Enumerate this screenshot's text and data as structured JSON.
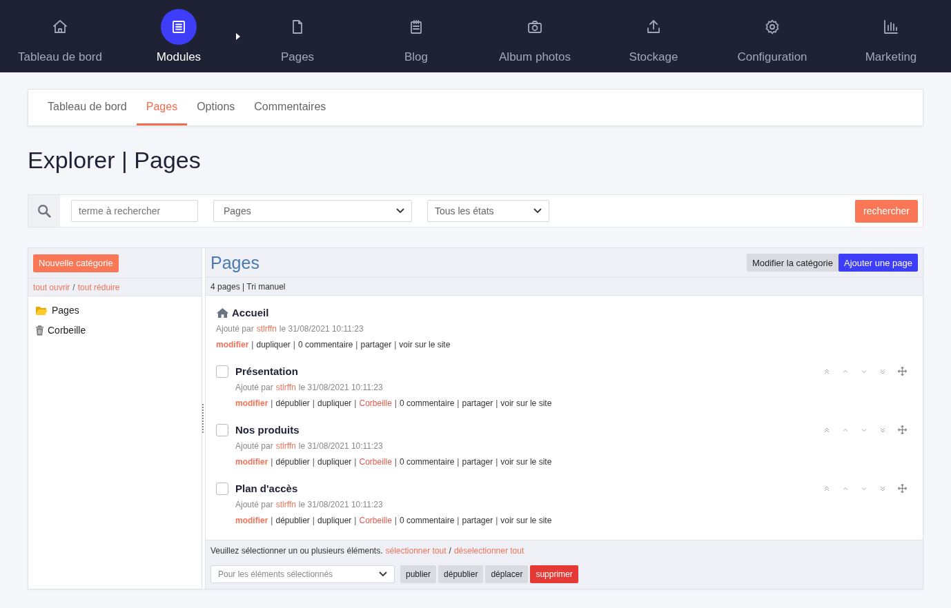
{
  "top_nav": [
    {
      "label": "Tableau de bord",
      "kind": "home",
      "selected": false
    },
    {
      "label": "Modules",
      "kind": "list",
      "selected": true
    },
    {
      "label": "Pages",
      "kind": "file",
      "selected": false
    },
    {
      "label": "Blog",
      "kind": "notepad",
      "selected": false
    },
    {
      "label": "Album photos",
      "kind": "camera",
      "selected": false
    },
    {
      "label": "Stockage",
      "kind": "upload",
      "selected": false
    },
    {
      "label": "Configuration",
      "kind": "gear",
      "selected": false
    },
    {
      "label": "Marketing",
      "kind": "chart",
      "selected": false
    }
  ],
  "sub_tabs": [
    {
      "label": "Tableau de bord",
      "selected": false
    },
    {
      "label": "Pages",
      "selected": true
    },
    {
      "label": "Options",
      "selected": false
    },
    {
      "label": "Commentaires",
      "selected": false
    }
  ],
  "page_title": "Explorer | Pages",
  "search": {
    "placeholder": "terme à rechercher",
    "category": "Pages",
    "state": "Tous les états",
    "button": "rechercher"
  },
  "sidebar": {
    "new_button": "Nouvelle catégorie",
    "expand_all": "tout ouvrir",
    "slash": "/",
    "collapse_all": "tout réduire",
    "tree": [
      {
        "label": "Pages",
        "kind": "folder"
      },
      {
        "label": "Corbeille",
        "kind": "trash"
      }
    ]
  },
  "content": {
    "title": "Pages",
    "buttons": [
      {
        "label": "Modifier la catégorie",
        "kind": "secondary"
      },
      {
        "label": "Ajouter une page",
        "kind": "primary"
      }
    ],
    "summary": "4 pages | Tri manuel",
    "pages": [
      {
        "title": "Accueil",
        "kind": "home",
        "added_by": "Ajouté par",
        "author": "stlrffn",
        "date": "le 31/08/2021 10:11:23",
        "actions": [
          {
            "label": "modifier",
            "kind": "edit"
          },
          {
            "sep": "|",
            "label": "dupliquer",
            "kind": "normal"
          },
          {
            "sep": "|",
            "label": "0 commentaire",
            "kind": "normal"
          },
          {
            "sep": "|",
            "label": "partager",
            "kind": "normal"
          },
          {
            "sep": "|",
            "label": "voir sur le site",
            "kind": "normal"
          }
        ]
      },
      {
        "title": "Présentation",
        "kind": "page",
        "checked": false,
        "added_by": "Ajouté par",
        "author": "stlrffn",
        "date": "le 31/08/2021 10:11:23",
        "actions": [
          {
            "label": "modifier",
            "kind": "edit"
          },
          {
            "sep": "|",
            "label": "dépublier",
            "kind": "normal"
          },
          {
            "sep": "|",
            "label": "dupliquer",
            "kind": "normal"
          },
          {
            "sep": "|",
            "label": "Corbeille",
            "kind": "trash"
          },
          {
            "sep": "|",
            "label": "0 commentaire",
            "kind": "normal"
          },
          {
            "sep": "|",
            "label": "partager",
            "kind": "normal"
          },
          {
            "sep": "|",
            "label": "voir sur le site",
            "kind": "normal"
          }
        ]
      },
      {
        "title": "Nos produits",
        "kind": "page",
        "checked": false,
        "added_by": "Ajouté par",
        "author": "stlrffn",
        "date": "le 31/08/2021 10:11:23",
        "actions": [
          {
            "label": "modifier",
            "kind": "edit"
          },
          {
            "sep": "|",
            "label": "dépublier",
            "kind": "normal"
          },
          {
            "sep": "|",
            "label": "dupliquer",
            "kind": "normal"
          },
          {
            "sep": "|",
            "label": "Corbeille",
            "kind": "trash"
          },
          {
            "sep": "|",
            "label": "0 commentaire",
            "kind": "normal"
          },
          {
            "sep": "|",
            "label": "partager",
            "kind": "normal"
          },
          {
            "sep": "|",
            "label": "voir sur le site",
            "kind": "normal"
          }
        ]
      },
      {
        "title": "Plan d'accès",
        "kind": "page",
        "checked": false,
        "added_by": "Ajouté par",
        "author": "stlrffn",
        "date": "le 31/08/2021 10:11:23",
        "actions": [
          {
            "label": "modifier",
            "kind": "edit"
          },
          {
            "sep": "|",
            "label": "dépublier",
            "kind": "normal"
          },
          {
            "sep": "|",
            "label": "dupliquer",
            "kind": "normal"
          },
          {
            "sep": "|",
            "label": "Corbeille",
            "kind": "trash"
          },
          {
            "sep": "|",
            "label": "0 commentaire",
            "kind": "normal"
          },
          {
            "sep": "|",
            "label": "partager",
            "kind": "normal"
          },
          {
            "sep": "|",
            "label": "voir sur le site",
            "kind": "normal"
          }
        ]
      }
    ],
    "footer": {
      "message": "Veuillez sélectionner un ou plusieurs éléments.",
      "select_all": "sélectionner tout",
      "slash": "/",
      "deselect_all": "déselectionner tout",
      "bulk_placeholder": "Pour les éléments sélectionnés",
      "buttons": [
        {
          "label": "publier",
          "kind": "secondary"
        },
        {
          "label": "dépublier",
          "kind": "secondary"
        },
        {
          "label": "déplacer",
          "kind": "secondary"
        },
        {
          "label": "supprimer",
          "kind": "danger"
        }
      ]
    }
  }
}
